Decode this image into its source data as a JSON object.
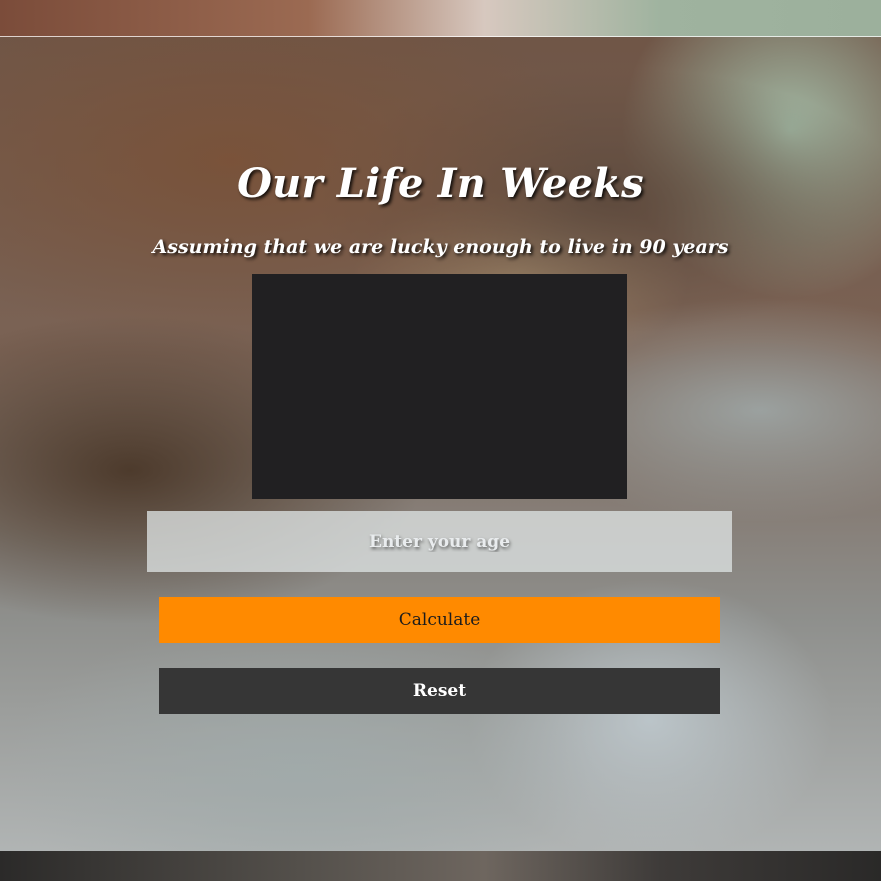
{
  "header": {
    "title": "Our Life In Weeks",
    "subtitle": "Assuming that we are lucky enough to live in 90 years"
  },
  "form": {
    "age_placeholder": "Enter your age",
    "age_value": "",
    "calculate_label": "Calculate",
    "reset_label": "Reset"
  },
  "colors": {
    "calculate_button": "#ff8a00",
    "reset_button": "#363636",
    "canvas": "#212022"
  }
}
